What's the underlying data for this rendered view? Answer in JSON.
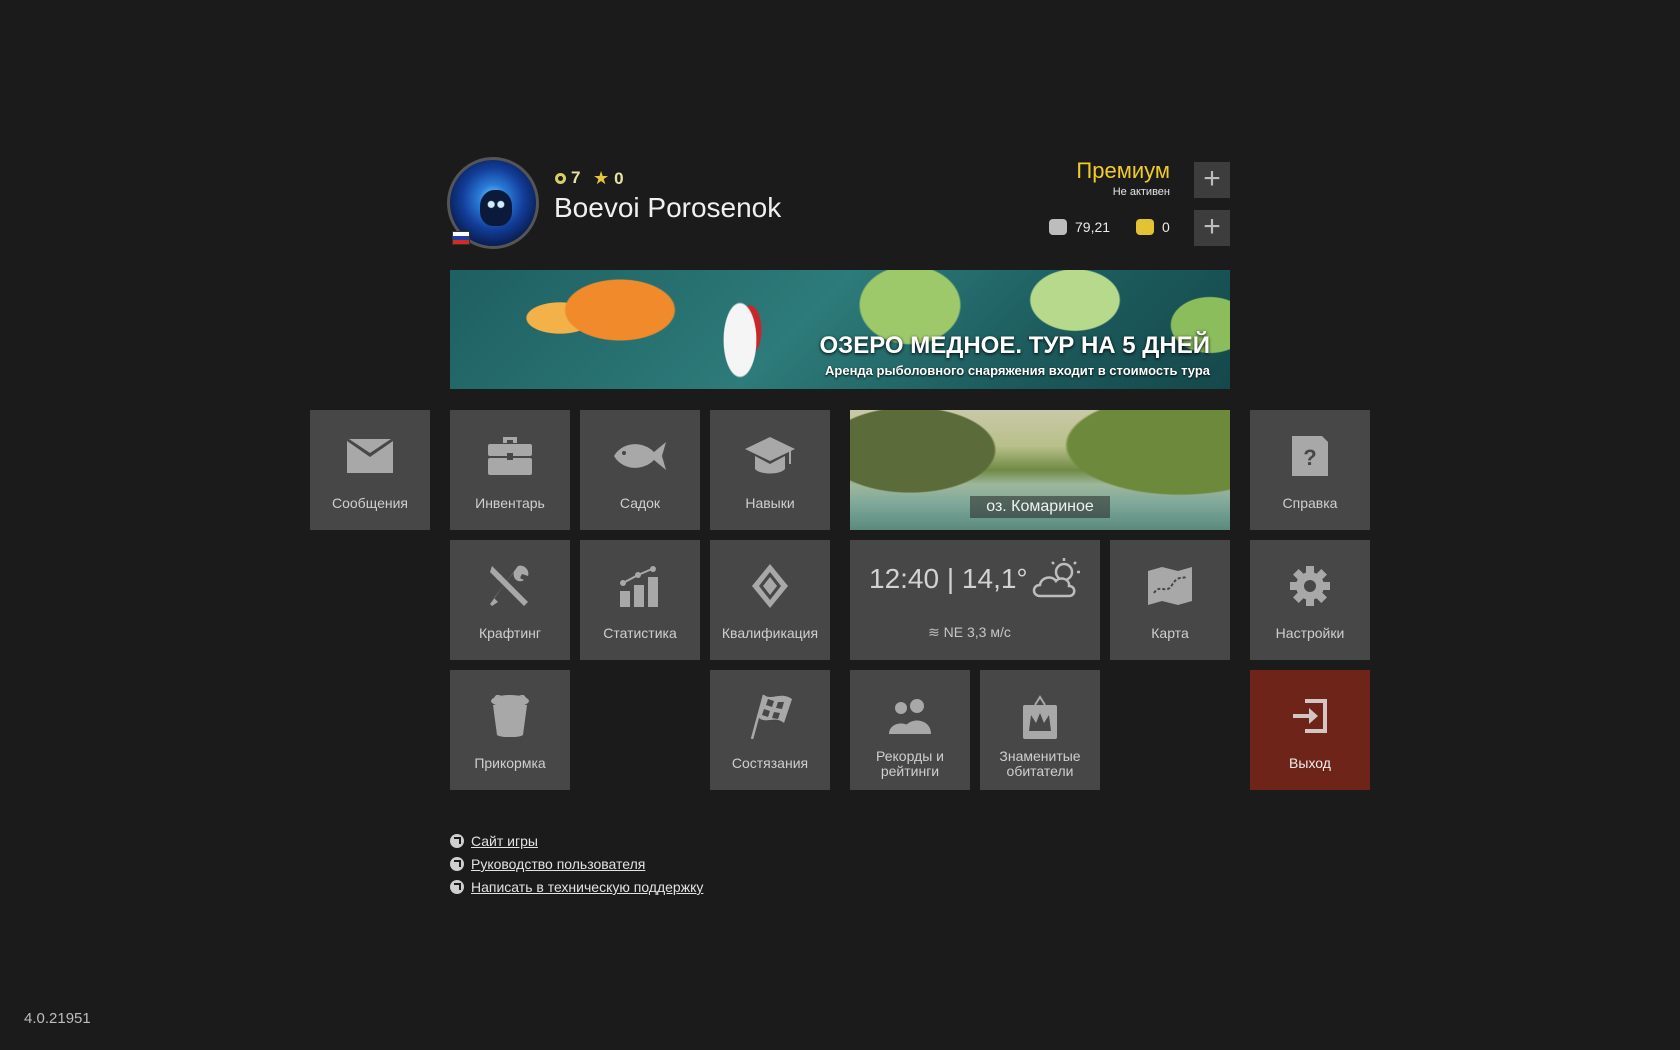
{
  "player": {
    "level": "7",
    "stars": "0",
    "name": "Boevoi Porosenok",
    "country_flag": [
      "#ffffff",
      "#1a3fa8",
      "#d52b1e"
    ]
  },
  "premium": {
    "title": "Премиум",
    "status": "Не активен"
  },
  "currency": {
    "silver": "79,21",
    "gold": "0"
  },
  "banner": {
    "title": "ОЗЕРО МЕДНОЕ. ТУР НА 5 ДНЕЙ",
    "subtitle": "Аренда рыболовного снаряжения входит в стоимость тура"
  },
  "menu": {
    "messages": "Сообщения",
    "inventory": "Инвентарь",
    "keepnet": "Садок",
    "skills": "Навыки",
    "help": "Справка",
    "crafting": "Крафтинг",
    "statistics": "Статистика",
    "qualification": "Квалификация",
    "map": "Карта",
    "settings": "Настройки",
    "groundbait": "Прикормка",
    "competitions": "Состязания",
    "records": "Рекорды и рейтинги",
    "trophies": "Знаменитые обитатели",
    "exit": "Выход"
  },
  "location": {
    "name": "оз. Комариное"
  },
  "weather": {
    "time": "12:40",
    "temperature": "14,1°",
    "wind": "NE  3,3 м/с",
    "icon": "partly-cloudy-icon"
  },
  "links": [
    "Сайт игры",
    "Руководство пользователя",
    "Написать в техническую поддержку"
  ],
  "version": "4.0.21951",
  "colors": {
    "background": "#1b1b1b",
    "tile": "#474747",
    "premium": "#f0cc2a",
    "exit": "#6f2419"
  }
}
